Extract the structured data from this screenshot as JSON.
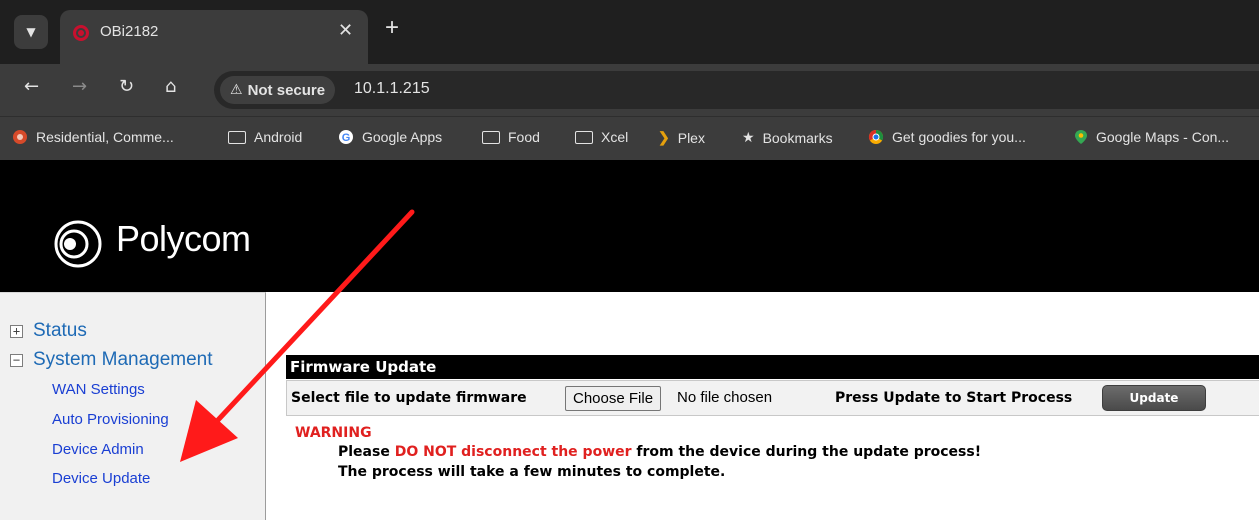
{
  "browser": {
    "tab": {
      "title": "OBi2182",
      "favicon": "polycom-favicon",
      "close": "✕"
    },
    "new_tab": "+",
    "nav": {
      "back": "←",
      "forward": "→",
      "reload": "↻",
      "home": "⌂"
    },
    "security": {
      "icon": "warning-triangle-icon",
      "glyph": "⚠",
      "label": "Not secure"
    },
    "url": "10.1.1.215",
    "bookmarks": [
      {
        "label": "Residential, Comme...",
        "icon": "site-favicon"
      },
      {
        "label": "Android",
        "icon": "folder-icon"
      },
      {
        "label": "Google Apps",
        "icon": "google-icon"
      },
      {
        "label": "Food",
        "icon": "folder-icon"
      },
      {
        "label": "Xcel",
        "icon": "folder-icon"
      },
      {
        "label": "Plex",
        "icon": "plex-icon"
      },
      {
        "label": "Bookmarks",
        "icon": "star-icon"
      },
      {
        "label": "Get goodies for you...",
        "icon": "chrome-icon"
      },
      {
        "label": "Google Maps - Con...",
        "icon": "maps-pin-icon"
      }
    ]
  },
  "brand": {
    "name": "Polycom",
    "logo_color": "#c8102e"
  },
  "sidebar": {
    "status": {
      "toggle": "+",
      "label": "Status"
    },
    "system_management": {
      "toggle": "−",
      "label": "System Management"
    },
    "items": [
      {
        "label": "WAN Settings"
      },
      {
        "label": "Auto Provisioning"
      },
      {
        "label": "Device Admin"
      },
      {
        "label": "Device Update"
      }
    ]
  },
  "firmware": {
    "title": "Firmware Update",
    "select_label": "Select file to update firmware",
    "choose_button": "Choose File",
    "file_status": "No file chosen",
    "press_label": "Press Update to Start Process",
    "update_button": "Update"
  },
  "warning": {
    "title": "WARNING",
    "line1_prefix": "Please ",
    "line1_emphasis": "DO NOT disconnect the power",
    "line1_suffix": " from the device during the update process!",
    "line2": "The process will take a few minutes to complete."
  },
  "colors": {
    "link": "#1a3fd3",
    "tree_link": "#1e6ab5",
    "warning": "#e0201f",
    "annotation_arrow": "#ff1a1a"
  }
}
